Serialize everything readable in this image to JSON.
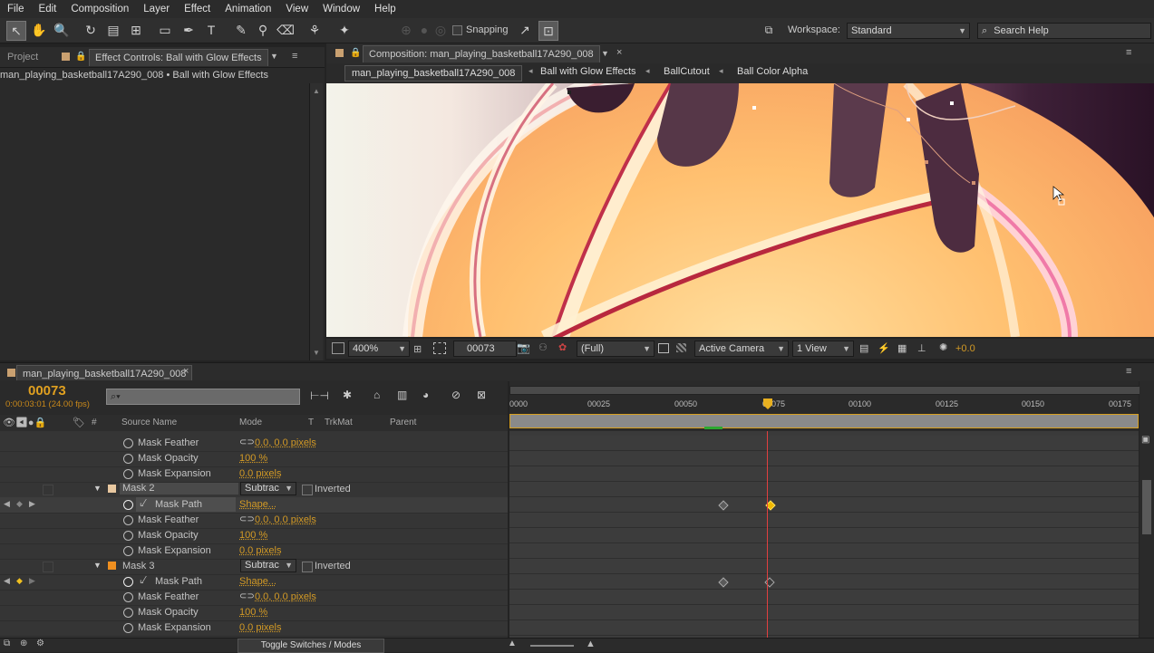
{
  "menu": [
    "File",
    "Edit",
    "Composition",
    "Layer",
    "Effect",
    "Animation",
    "View",
    "Window",
    "Help"
  ],
  "toolbar": {
    "snapping_label": "Snapping",
    "workspace_label": "Workspace:",
    "workspace_value": "Standard",
    "search_placeholder": "Search Help"
  },
  "left_panel": {
    "tab_project": "Project",
    "tab_effect_controls": "Effect Controls: Ball with Glow Effects",
    "breadcrumb": "man_playing_basketball17A290_008 • Ball with Glow Effects"
  },
  "comp_panel": {
    "tab": "Composition: man_playing_basketball17A290_008",
    "flow": [
      "man_playing_basketball17A290_008",
      "Ball with Glow Effects",
      "BallCutout",
      "Ball Color Alpha"
    ],
    "footer": {
      "zoom": "400%",
      "timecode": "00073",
      "resolution": "(Full)",
      "camera": "Active Camera",
      "views": "1 View",
      "exposure": "+0.0"
    }
  },
  "timeline": {
    "tab": "man_playing_basketball17A290_008",
    "current_frame": "00073",
    "current_time": "0:00:03:01 (24.00 fps)",
    "columns": {
      "source": "Source Name",
      "mode": "Mode",
      "t": "T",
      "trkmat": "TrkMat",
      "parent": "Parent",
      "hash": "#"
    },
    "ruler": [
      "0000",
      "00025",
      "00050",
      "00075",
      "00100",
      "00125",
      "00150",
      "00175"
    ],
    "footer_button": "Toggle Switches / Modes",
    "rows": [
      {
        "label": "Mask Feather",
        "value": "0.0, 0.0 pixels"
      },
      {
        "label": "Mask Opacity",
        "value": "100 %"
      },
      {
        "label": "Mask Expansion",
        "value": "0.0 pixels"
      },
      {
        "label": "Mask 2",
        "mode": "Subtrac",
        "inverted": "Inverted"
      },
      {
        "label": "Mask Path",
        "value": "Shape..."
      },
      {
        "label": "Mask Feather",
        "value": "0.0, 0.0 pixels"
      },
      {
        "label": "Mask Opacity",
        "value": "100 %"
      },
      {
        "label": "Mask Expansion",
        "value": "0.0 pixels"
      },
      {
        "label": "Mask 3",
        "mode": "Subtrac",
        "inverted": "Inverted"
      },
      {
        "label": "Mask Path",
        "value": "Shape..."
      },
      {
        "label": "Mask Feather",
        "value": "0.0, 0.0 pixels"
      },
      {
        "label": "Mask Opacity",
        "value": "100 %"
      },
      {
        "label": "Mask Expansion",
        "value": "0.0 pixels"
      }
    ]
  },
  "colors": {
    "accent": "#d39a25",
    "playhead": "#e04040",
    "mask2": "#e8c8a0",
    "mask3": "#f09020"
  }
}
